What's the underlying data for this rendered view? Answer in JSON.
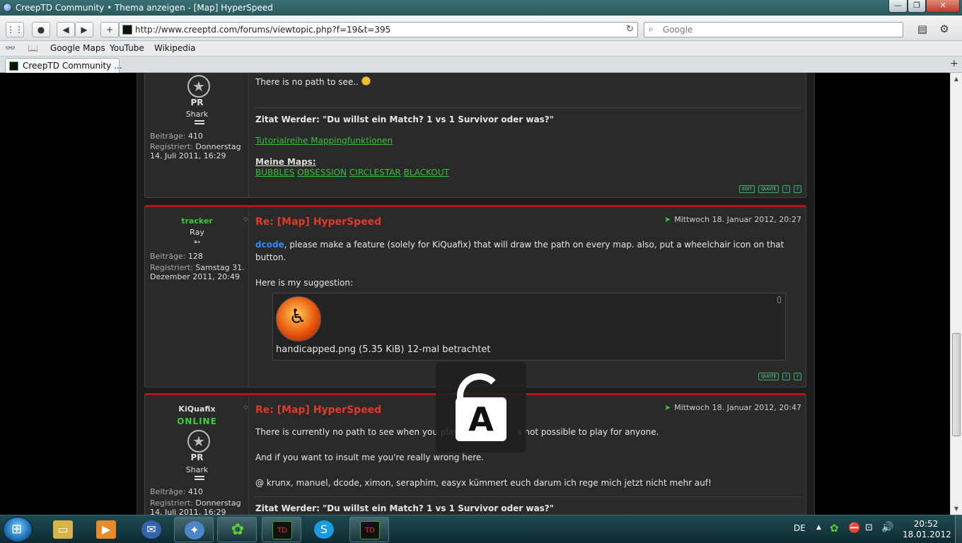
{
  "window": {
    "title": "CreepTD Community • Thema anzeigen - [Map] HyperSpeed"
  },
  "toolbar": {
    "url": "http://www.creeptd.com/forums/viewtopic.php?f=19&t=395",
    "search_placeholder": "Google"
  },
  "bookmarks": [
    "Google Maps",
    "YouTube",
    "Wikipedia"
  ],
  "tab": {
    "label": "CreepTD Community ..."
  },
  "post1": {
    "pr": "PR",
    "rank": "Shark",
    "beitraege_label": "Beiträge:",
    "beitraege": "410",
    "registriert_label": "Registriert:",
    "registriert": "Donnerstag",
    "registriert2": "14. Juli 2011, 16:29",
    "text": "There is no path to see..",
    "sig_quote": "Zitat Werder: \"Du willst ein Match? 1 vs 1 Survivor oder was?\"",
    "sig_link": "Tutorialreihe Mappingfunktionen",
    "sig_maps_label": "Meine Maps:",
    "sig_maps": [
      "BUBBLES",
      "OBSESSION",
      "CIRCLESTAR",
      "BLACKOUT"
    ],
    "buttons": [
      "EDIT",
      "QUOTE",
      "!",
      "?"
    ]
  },
  "post2": {
    "username": "tracker",
    "rank": "Ray",
    "beitraege_label": "Beiträge:",
    "beitraege": "128",
    "registriert_label": "Registriert:",
    "registriert": "Samstag 31.",
    "registriert2": "Dezember 2011, 20:49",
    "subject": "Re: [Map] HyperSpeed",
    "date": "Mittwoch 18. Januar 2012, 20:27",
    "mention": "dcode",
    "text1": ", please make a feature (solely for KiQuafix) that will draw the path on every map. also, put a wheelchair icon on that",
    "text1b": "button.",
    "text2": "Here is my suggestion:",
    "attachment_caption": "handicapped.png (5.35 KiB) 12-mal betrachtet",
    "buttons": [
      "QUOTE",
      "!",
      "?"
    ]
  },
  "post3": {
    "username": "KiQuafix",
    "online": "ONLINE",
    "pr": "PR",
    "rank": "Shark",
    "beitraege_label": "Beiträge:",
    "beitraege": "410",
    "registriert_label": "Registriert:",
    "registriert": "Donnerstag",
    "registriert2": "14. Juli 2011, 16:29",
    "subject": "Re: [Map] HyperSpeed",
    "date": "Mittwoch 18. Januar 2012, 20:47",
    "text1a": "There is currently no path to see when you play i",
    "text1b": "s not possible to play for anyone.",
    "text2": "And if you want to insult me you're really wrong here.",
    "text3": "@ krunx, manuel, dcode, ximon, seraphim, easyx kümmert euch darum ich rege mich jetzt nicht mehr auf!",
    "sig_quote": "Zitat Werder: \"Du willst ein Match? 1 vs 1 Survivor oder was?\""
  },
  "taskbar": {
    "lang": "DE",
    "time": "20:52",
    "date": "18.01.2012"
  },
  "colors": {
    "subject_red": "#e03a2a",
    "link_green": "#38c03a",
    "mention_blue": "#2f88ff",
    "online_green": "#39d13a"
  }
}
